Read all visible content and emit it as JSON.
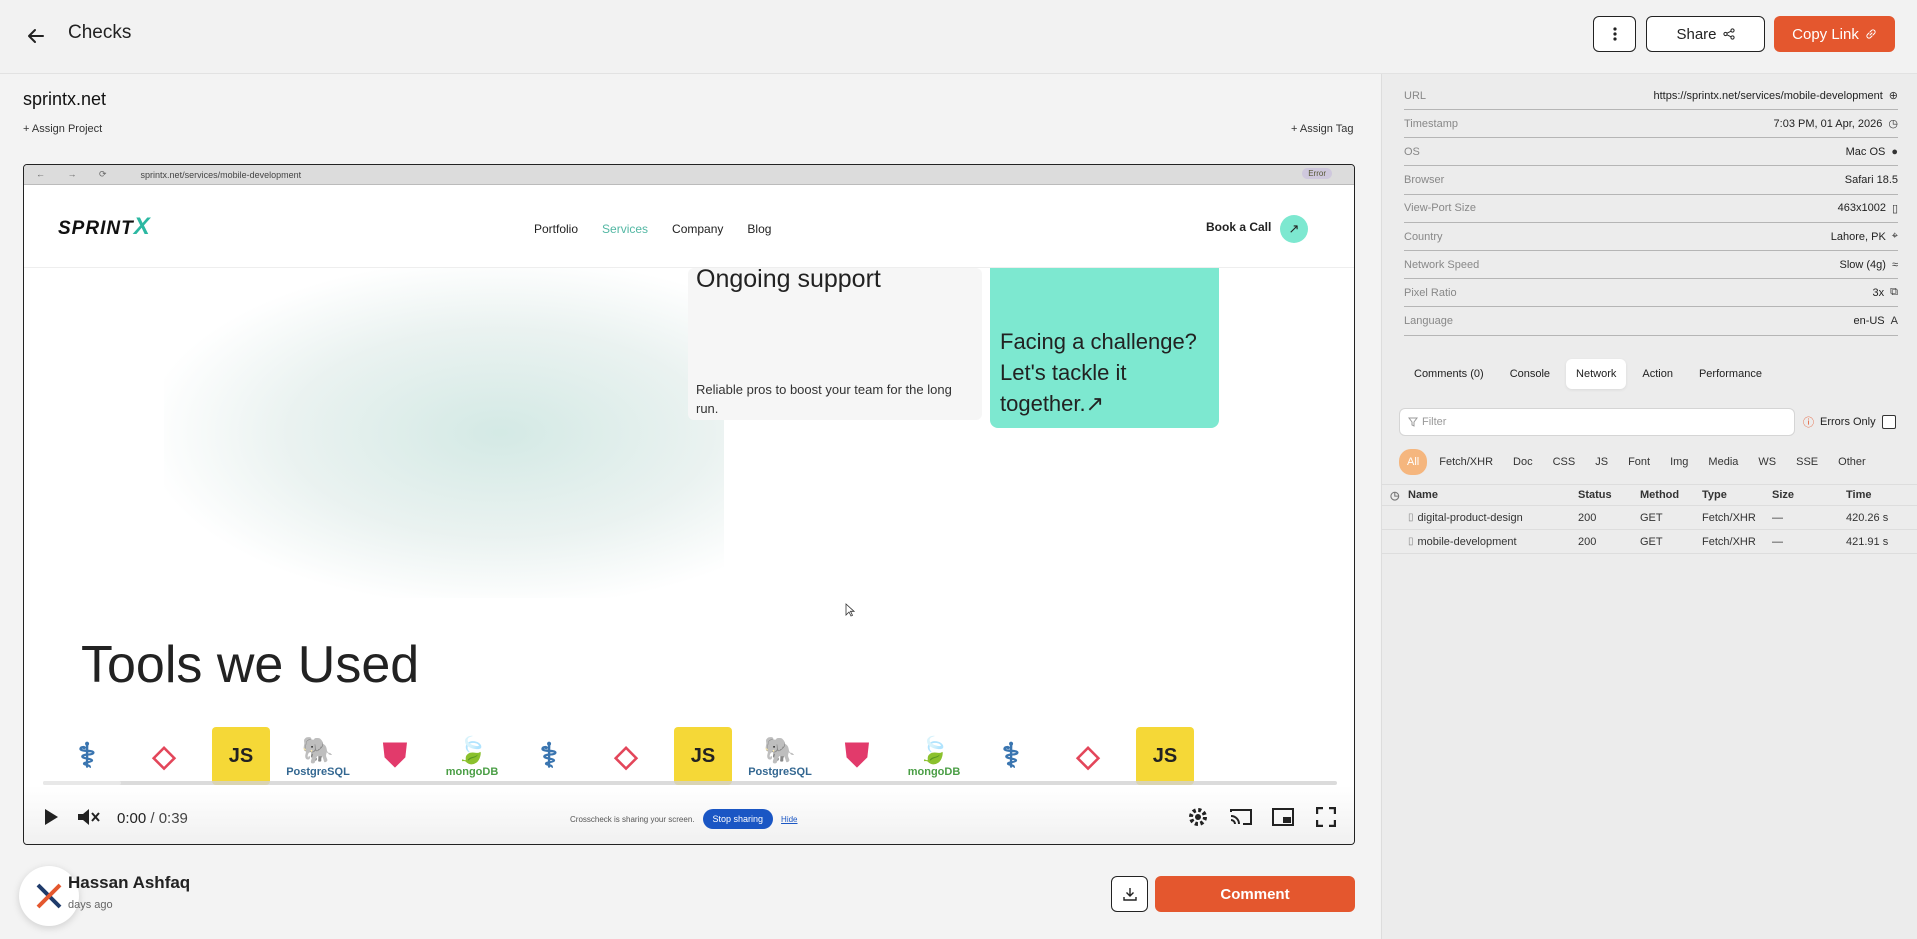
{
  "header": {
    "title": "Checks",
    "share_label": "Share",
    "copy_label": "Copy Link",
    "more_icon": "more-vertical-icon"
  },
  "check": {
    "site": "sprintx.net",
    "assign_project": "+ Assign Project",
    "assign_tag": "+ Assign Tag"
  },
  "recording": {
    "browser_url": "sprintx.net/services/mobile-development",
    "browser_error": "Error",
    "site_nav": {
      "logo": "SPRINT",
      "logo_x": "X",
      "links": [
        "Portfolio",
        "Services",
        "Company",
        "Blog"
      ],
      "active_link": "Services",
      "cta": "Book a Call"
    },
    "card1_title": "Ongoing support",
    "card1_text": "Reliable pros to boost your team for the long run.",
    "card2_text": "Facing a challenge? Let's tackle it together.",
    "tools_title": "Tools we Used",
    "tool_icons": [
      "JS",
      "PostgreSQL",
      "mongoDB"
    ],
    "player": {
      "current_time": "0:00",
      "duration": "/ 0:39",
      "progress": 0.06,
      "share_notice": "Crosscheck is sharing your screen.",
      "stop_sharing": "Stop sharing",
      "hide": "Hide"
    }
  },
  "author": {
    "name": "Hassan Ashfaq",
    "time": "days ago"
  },
  "actions": {
    "comment": "Comment"
  },
  "meta": [
    {
      "key": "URL",
      "value": "https://sprintx.net/services/mobile-development",
      "icon": "globe-icon",
      "glyph": "⊕"
    },
    {
      "key": "Timestamp",
      "value": "7:03 PM, 01 Apr, 2026",
      "icon": "clock-icon",
      "glyph": "◷"
    },
    {
      "key": "OS",
      "value": "Mac OS",
      "icon": "apple-icon",
      "glyph": "●"
    },
    {
      "key": "Browser",
      "value": "Safari 18.5",
      "icon": "",
      "glyph": ""
    },
    {
      "key": "View-Port Size",
      "value": "463x1002",
      "icon": "device-icon",
      "glyph": "▯"
    },
    {
      "key": "Country",
      "value": "Lahore, PK",
      "icon": "location-icon",
      "glyph": "⌖"
    },
    {
      "key": "Network Speed",
      "value": "Slow (4g)",
      "icon": "wifi-icon",
      "glyph": "≈"
    },
    {
      "key": "Pixel Ratio",
      "value": "3x",
      "icon": "ratio-icon",
      "glyph": "⧉"
    },
    {
      "key": "Language",
      "value": "en-US",
      "icon": "translate-icon",
      "glyph": "A"
    }
  ],
  "tabs": {
    "comments": "Comments (0)",
    "console": "Console",
    "network": "Network",
    "action": "Action",
    "performance": "Performance"
  },
  "network": {
    "filter_placeholder": "Filter",
    "errors_only": "Errors Only",
    "types": [
      "All",
      "Fetch/XHR",
      "Doc",
      "CSS",
      "JS",
      "Font",
      "Img",
      "Media",
      "WS",
      "SSE",
      "Other"
    ],
    "columns": {
      "name": "Name",
      "status": "Status",
      "method": "Method",
      "type": "Type",
      "size": "Size",
      "time": "Time"
    },
    "rows": [
      {
        "name": "digital-product-design",
        "status": "200",
        "method": "GET",
        "type": "Fetch/XHR",
        "size": "—",
        "time": "420.26 s"
      },
      {
        "name": "mobile-development",
        "status": "200",
        "method": "GET",
        "type": "Fetch/XHR",
        "size": "—",
        "time": "421.91 s"
      }
    ]
  },
  "colors": {
    "accent": "#e4572e",
    "teal": "#7de8d0",
    "blue": "#1a56c4"
  }
}
